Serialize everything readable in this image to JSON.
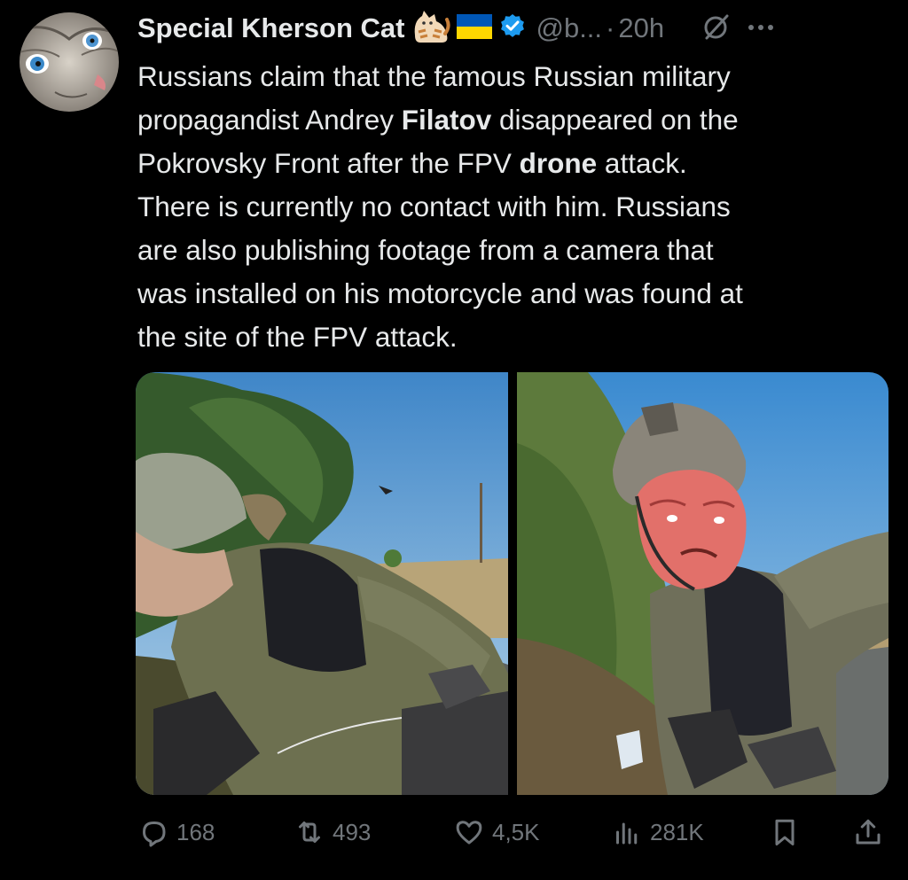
{
  "tweet": {
    "author": {
      "display_name": "Special Kherson Cat",
      "handle": "@b...",
      "verified": true,
      "badges": [
        "cat-emoji",
        "ukraine-flag-emoji",
        "verified-badge-icon"
      ]
    },
    "separator": "·",
    "time": "20h",
    "text": {
      "line1": "Russians claim that the famous Russian military",
      "line2_a": "propagandist Andrey ",
      "line2_b": "Filatov",
      "line2_c": " disappeared on the",
      "line3_a": "Pokrovsky Front after the FPV ",
      "line3_b": "drone",
      "line3_c": " attack.",
      "line4": "There is currently no contact with him. Russians",
      "line5": "are also publishing footage from a camera that",
      "line6": "was installed on his motorcycle and was found at",
      "line7": "the site of the FPV attack."
    },
    "media": {
      "count": 2,
      "photos": [
        "soldier-on-motorcycle-photo",
        "wounded-soldier-selfie-photo"
      ]
    },
    "metrics": {
      "replies": "168",
      "reposts": "493",
      "likes": "4,5K",
      "views": "281K"
    }
  },
  "icons": {
    "reply": "reply-icon",
    "repost": "repost-icon",
    "like": "heart-icon",
    "views": "views-bar-chart-icon",
    "bookmark": "bookmark-icon",
    "share": "share-icon",
    "grok": "grok-icon",
    "more": "more-dots-icon"
  },
  "colors": {
    "background": "#000000",
    "text": "#e7e9ea",
    "secondary": "#71767b",
    "verified_blue": "#1d9bf0",
    "ukraine_blue": "#0057b7",
    "ukraine_yellow": "#ffd700"
  }
}
